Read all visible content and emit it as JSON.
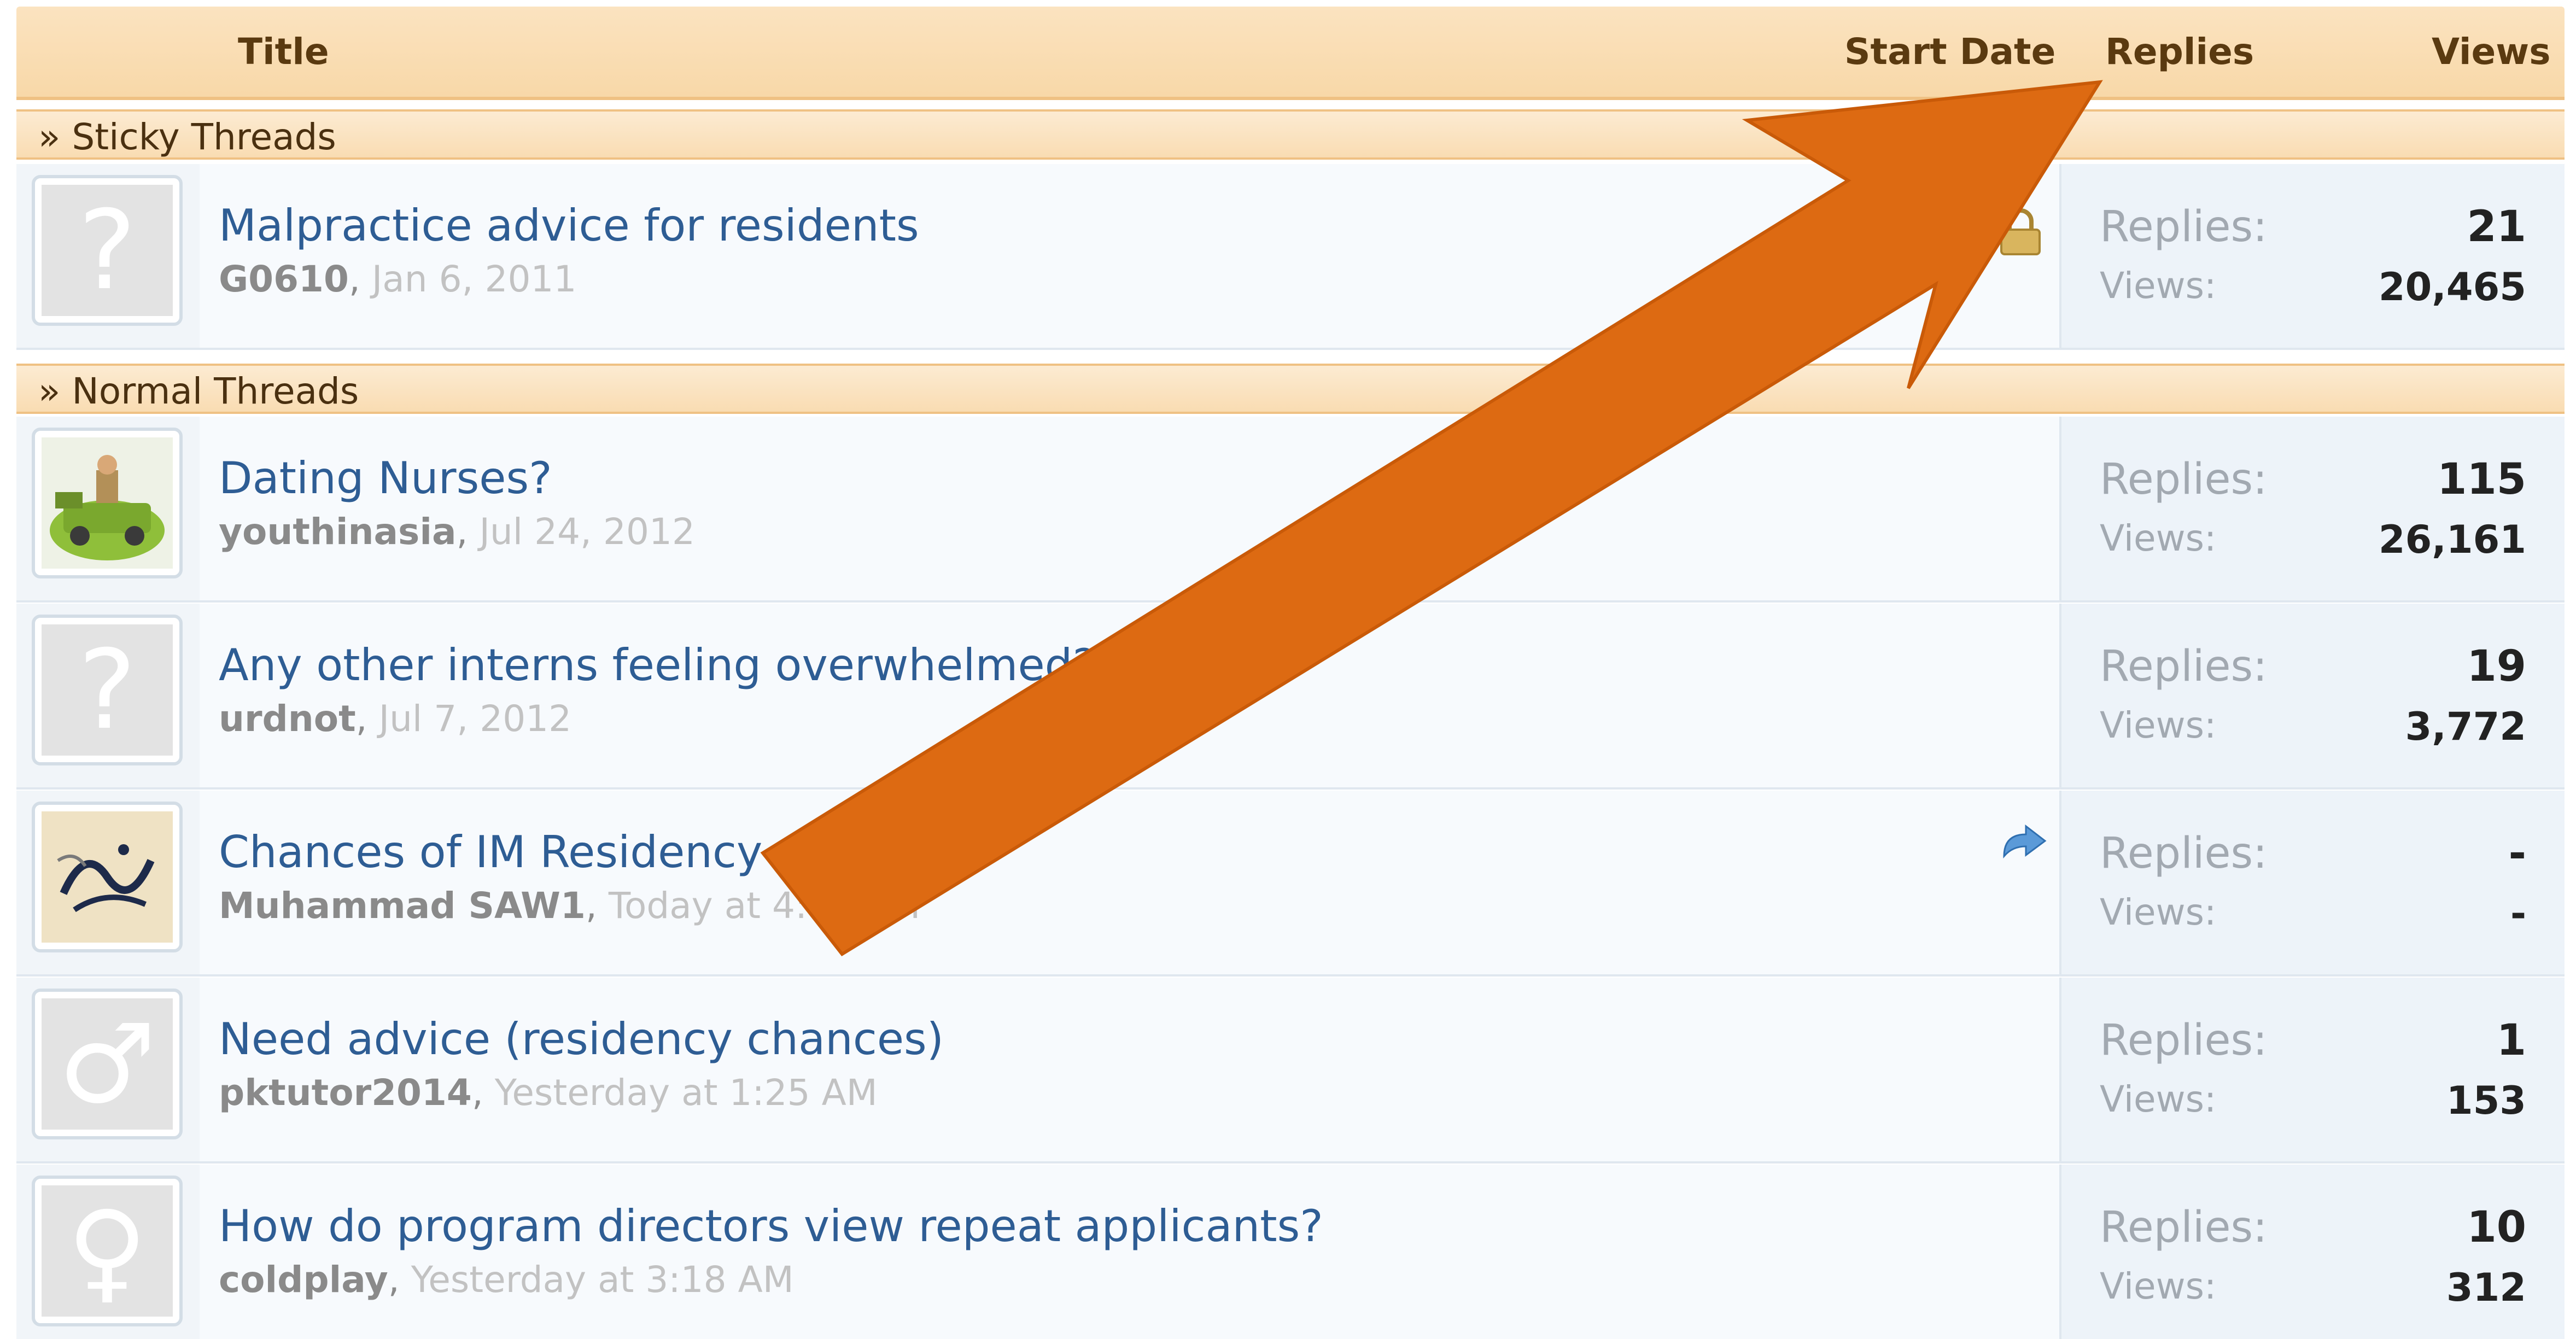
{
  "header": {
    "title": "Title",
    "start_date": "Start Date",
    "replies": "Replies",
    "views": "Views"
  },
  "sections": {
    "sticky": "» Sticky Threads",
    "normal": "» Normal Threads"
  },
  "stat_labels": {
    "replies": "Replies:",
    "views": "Views:"
  },
  "threads": [
    {
      "title": "Malpractice advice for residents",
      "author": "G0610",
      "date": "Jan 6, 2011",
      "replies": "21",
      "views": "20,465",
      "avatar_icon": "question-mark-icon",
      "status_icon": "lock-icon"
    },
    {
      "title": "Dating Nurses?",
      "author": "youthinasia",
      "date": "Jul 24, 2012",
      "replies": "115",
      "views": "26,161",
      "avatar_icon": "user-photo-avatar"
    },
    {
      "title": "Any other interns feeling overwhelmed?",
      "author": "urdnot",
      "date": "Jul 7, 2012",
      "replies": "19",
      "views": "3,772",
      "avatar_icon": "question-mark-icon"
    },
    {
      "title": "Chances of IM Residency",
      "author": "Muhammad SAW1",
      "date": "Today at 4:02 AM",
      "replies": "-",
      "views": "-",
      "avatar_icon": "calligraphy-avatar",
      "status_icon": "redirect-arrow-icon"
    },
    {
      "title": "Need advice (residency chances)",
      "author": "pktutor2014",
      "date": "Yesterday at 1:25 AM",
      "replies": "1",
      "views": "153",
      "avatar_icon": "male-symbol-icon"
    },
    {
      "title": "How do program directors view repeat applicants?",
      "author": "coldplay",
      "date": "Yesterday at 3:18 AM",
      "replies": "10",
      "views": "312",
      "avatar_icon": "female-symbol-icon"
    }
  ],
  "colors": {
    "header_bg": "#f8d8a8",
    "link": "#2e5d94",
    "annotation_arrow": "#dd6a12"
  },
  "annotation": {
    "arrow_icon": "annotation-arrow-icon"
  }
}
